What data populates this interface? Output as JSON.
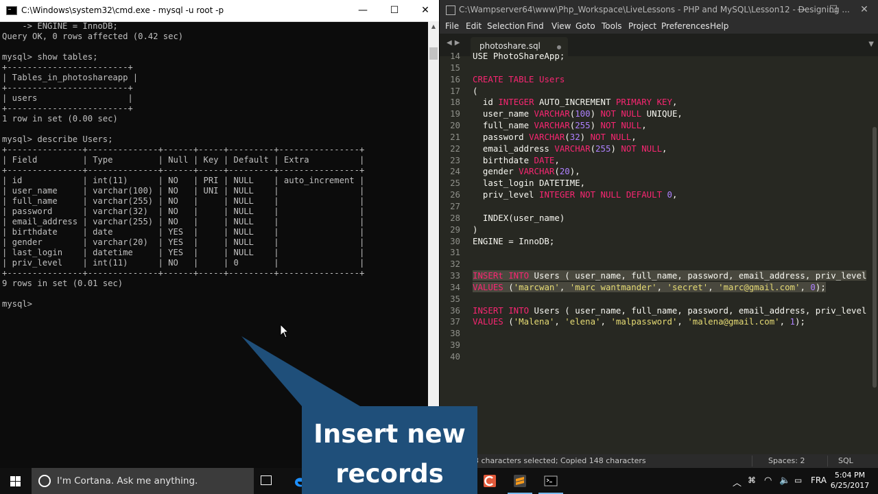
{
  "cmd": {
    "title": "C:\\Windows\\system32\\cmd.exe - mysql  -u root -p",
    "controls": [
      "—",
      "☐",
      "✕"
    ],
    "lines": [
      "    -> ENGINE = InnoDB;",
      "Query OK, 0 rows affected (0.42 sec)",
      "",
      "mysql> show tables;",
      "+------------------------+",
      "| Tables_in_photoshareapp |",
      "+------------------------+",
      "| users                  |",
      "+------------------------+",
      "1 row in set (0.00 sec)",
      "",
      "mysql> describe Users;",
      "+---------------+--------------+------+-----+---------+----------------+",
      "| Field         | Type         | Null | Key | Default | Extra          |",
      "+---------------+--------------+------+-----+---------+----------------+",
      "| id            | int(11)      | NO   | PRI | NULL    | auto_increment |",
      "| user_name     | varchar(100) | NO   | UNI | NULL    |                |",
      "| full_name     | varchar(255) | NO   |     | NULL    |                |",
      "| password      | varchar(32)  | NO   |     | NULL    |                |",
      "| email_address | varchar(255) | NO   |     | NULL    |                |",
      "| birthdate     | date         | YES  |     | NULL    |                |",
      "| gender        | varchar(20)  | YES  |     | NULL    |                |",
      "| last_login    | datetime     | YES  |     | NULL    |                |",
      "| priv_level    | int(11)      | NO   |     | 0       |                |",
      "+---------------+--------------+------+-----+---------+----------------+",
      "9 rows in set (0.01 sec)",
      "",
      "mysql>"
    ]
  },
  "sublime": {
    "title": "C:\\Wampserver64\\www\\Php_Workspace\\LiveLessons - PHP and MySQL\\Lesson12 - Designing ...",
    "menu": [
      "File",
      "Edit",
      "Selection",
      "Find",
      "View",
      "Goto",
      "Tools",
      "Project",
      "Preferences",
      "Help"
    ],
    "tab_name": "photoshare.sql",
    "line_numbers": [
      "14",
      "15",
      "16",
      "17",
      "18",
      "19",
      "20",
      "21",
      "22",
      "23",
      "24",
      "25",
      "26",
      "27",
      "28",
      "29",
      "30",
      "31",
      "32",
      "33",
      "34",
      "35",
      "36",
      "37",
      "38",
      "39",
      "40"
    ],
    "code_lines": [
      [
        {
          "t": "USE PhotoShareApp;",
          "c": "pl"
        }
      ],
      [],
      [
        {
          "t": "CREATE TABLE ",
          "c": "kw"
        },
        {
          "t": "Users",
          "c": "kw"
        }
      ],
      [
        {
          "t": "(",
          "c": "pl"
        }
      ],
      [
        {
          "t": "  id ",
          "c": "pl"
        },
        {
          "t": "INTEGER",
          "c": "kw"
        },
        {
          "t": " AUTO_INCREMENT ",
          "c": "pl"
        },
        {
          "t": "PRIMARY KEY",
          "c": "kw"
        },
        {
          "t": ",",
          "c": "pl"
        }
      ],
      [
        {
          "t": "  user_name ",
          "c": "pl"
        },
        {
          "t": "VARCHAR",
          "c": "kw"
        },
        {
          "t": "(",
          "c": "pl"
        },
        {
          "t": "100",
          "c": "num"
        },
        {
          "t": ") ",
          "c": "pl"
        },
        {
          "t": "NOT NULL",
          "c": "kw"
        },
        {
          "t": " UNIQUE,",
          "c": "pl"
        }
      ],
      [
        {
          "t": "  full_name ",
          "c": "pl"
        },
        {
          "t": "VARCHAR",
          "c": "kw"
        },
        {
          "t": "(",
          "c": "pl"
        },
        {
          "t": "255",
          "c": "num"
        },
        {
          "t": ") ",
          "c": "pl"
        },
        {
          "t": "NOT NULL",
          "c": "kw"
        },
        {
          "t": ",",
          "c": "pl"
        }
      ],
      [
        {
          "t": "  password ",
          "c": "pl"
        },
        {
          "t": "VARCHAR",
          "c": "kw"
        },
        {
          "t": "(",
          "c": "pl"
        },
        {
          "t": "32",
          "c": "num"
        },
        {
          "t": ") ",
          "c": "pl"
        },
        {
          "t": "NOT NULL",
          "c": "kw"
        },
        {
          "t": ",",
          "c": "pl"
        }
      ],
      [
        {
          "t": "  email_address ",
          "c": "pl"
        },
        {
          "t": "VARCHAR",
          "c": "kw"
        },
        {
          "t": "(",
          "c": "pl"
        },
        {
          "t": "255",
          "c": "num"
        },
        {
          "t": ") ",
          "c": "pl"
        },
        {
          "t": "NOT NULL",
          "c": "kw"
        },
        {
          "t": ",",
          "c": "pl"
        }
      ],
      [
        {
          "t": "  birthdate ",
          "c": "pl"
        },
        {
          "t": "DATE",
          "c": "kw"
        },
        {
          "t": ",",
          "c": "pl"
        }
      ],
      [
        {
          "t": "  gender ",
          "c": "pl"
        },
        {
          "t": "VARCHAR",
          "c": "kw"
        },
        {
          "t": "(",
          "c": "pl"
        },
        {
          "t": "20",
          "c": "num"
        },
        {
          "t": "),",
          "c": "pl"
        }
      ],
      [
        {
          "t": "  last_login DATETIME,",
          "c": "pl"
        }
      ],
      [
        {
          "t": "  priv_level ",
          "c": "pl"
        },
        {
          "t": "INTEGER",
          "c": "kw"
        },
        {
          "t": " ",
          "c": "pl"
        },
        {
          "t": "NOT NULL",
          "c": "kw"
        },
        {
          "t": " ",
          "c": "pl"
        },
        {
          "t": "DEFAULT",
          "c": "kw"
        },
        {
          "t": " ",
          "c": "pl"
        },
        {
          "t": "0",
          "c": "num"
        },
        {
          "t": ",",
          "c": "pl"
        }
      ],
      [],
      [
        {
          "t": "  INDEX(user_name)",
          "c": "pl"
        }
      ],
      [
        {
          "t": ")",
          "c": "pl"
        }
      ],
      [
        {
          "t": "ENGINE = InnoDB;",
          "c": "pl"
        }
      ],
      [],
      [],
      [
        {
          "t": "INSERt INTO",
          "c": "kw"
        },
        {
          "t": " Users ( user_name, full_name, password, email_address, priv_level",
          "c": "pl"
        }
      ],
      [
        {
          "t": "VALUES",
          "c": "kw"
        },
        {
          "t": " (",
          "c": "pl"
        },
        {
          "t": "'marcwan'",
          "c": "str"
        },
        {
          "t": ", ",
          "c": "pl"
        },
        {
          "t": "'marc wantmander'",
          "c": "str"
        },
        {
          "t": ", ",
          "c": "pl"
        },
        {
          "t": "'secret'",
          "c": "str"
        },
        {
          "t": ", ",
          "c": "pl"
        },
        {
          "t": "'marc@gmail.com'",
          "c": "str"
        },
        {
          "t": ", ",
          "c": "pl"
        },
        {
          "t": "0",
          "c": "num"
        },
        {
          "t": ");",
          "c": "pl"
        }
      ],
      [],
      [
        {
          "t": "INSERT INTO",
          "c": "kw"
        },
        {
          "t": " Users ( user_name, full_name, password, email_address, priv_level",
          "c": "pl"
        }
      ],
      [
        {
          "t": "VALUES",
          "c": "kw"
        },
        {
          "t": " (",
          "c": "pl"
        },
        {
          "t": "'Malena'",
          "c": "str"
        },
        {
          "t": ", ",
          "c": "pl"
        },
        {
          "t": "'elena'",
          "c": "str"
        },
        {
          "t": ", ",
          "c": "pl"
        },
        {
          "t": "'malpassword'",
          "c": "str"
        },
        {
          "t": ", ",
          "c": "pl"
        },
        {
          "t": "'malena@gmail.com'",
          "c": "str"
        },
        {
          "t": ", ",
          "c": "pl"
        },
        {
          "t": "1",
          "c": "num"
        },
        {
          "t": ");",
          "c": "pl"
        }
      ],
      [],
      [],
      []
    ],
    "selected_lines": [
      19,
      20
    ],
    "status_left": "3 characters selected; Copied 148 characters",
    "status_spaces": "Spaces: 2",
    "status_syntax": "SQL"
  },
  "taskbar": {
    "cortana_placeholder": "I'm Cortana. Ask me anything.",
    "lang": "FRA",
    "time": "5:04 PM",
    "date": "6/25/2017"
  },
  "overlay": {
    "callout_text_1": "Insert new",
    "callout_text_2": "records",
    "callout_color": "#1f4f7a"
  }
}
